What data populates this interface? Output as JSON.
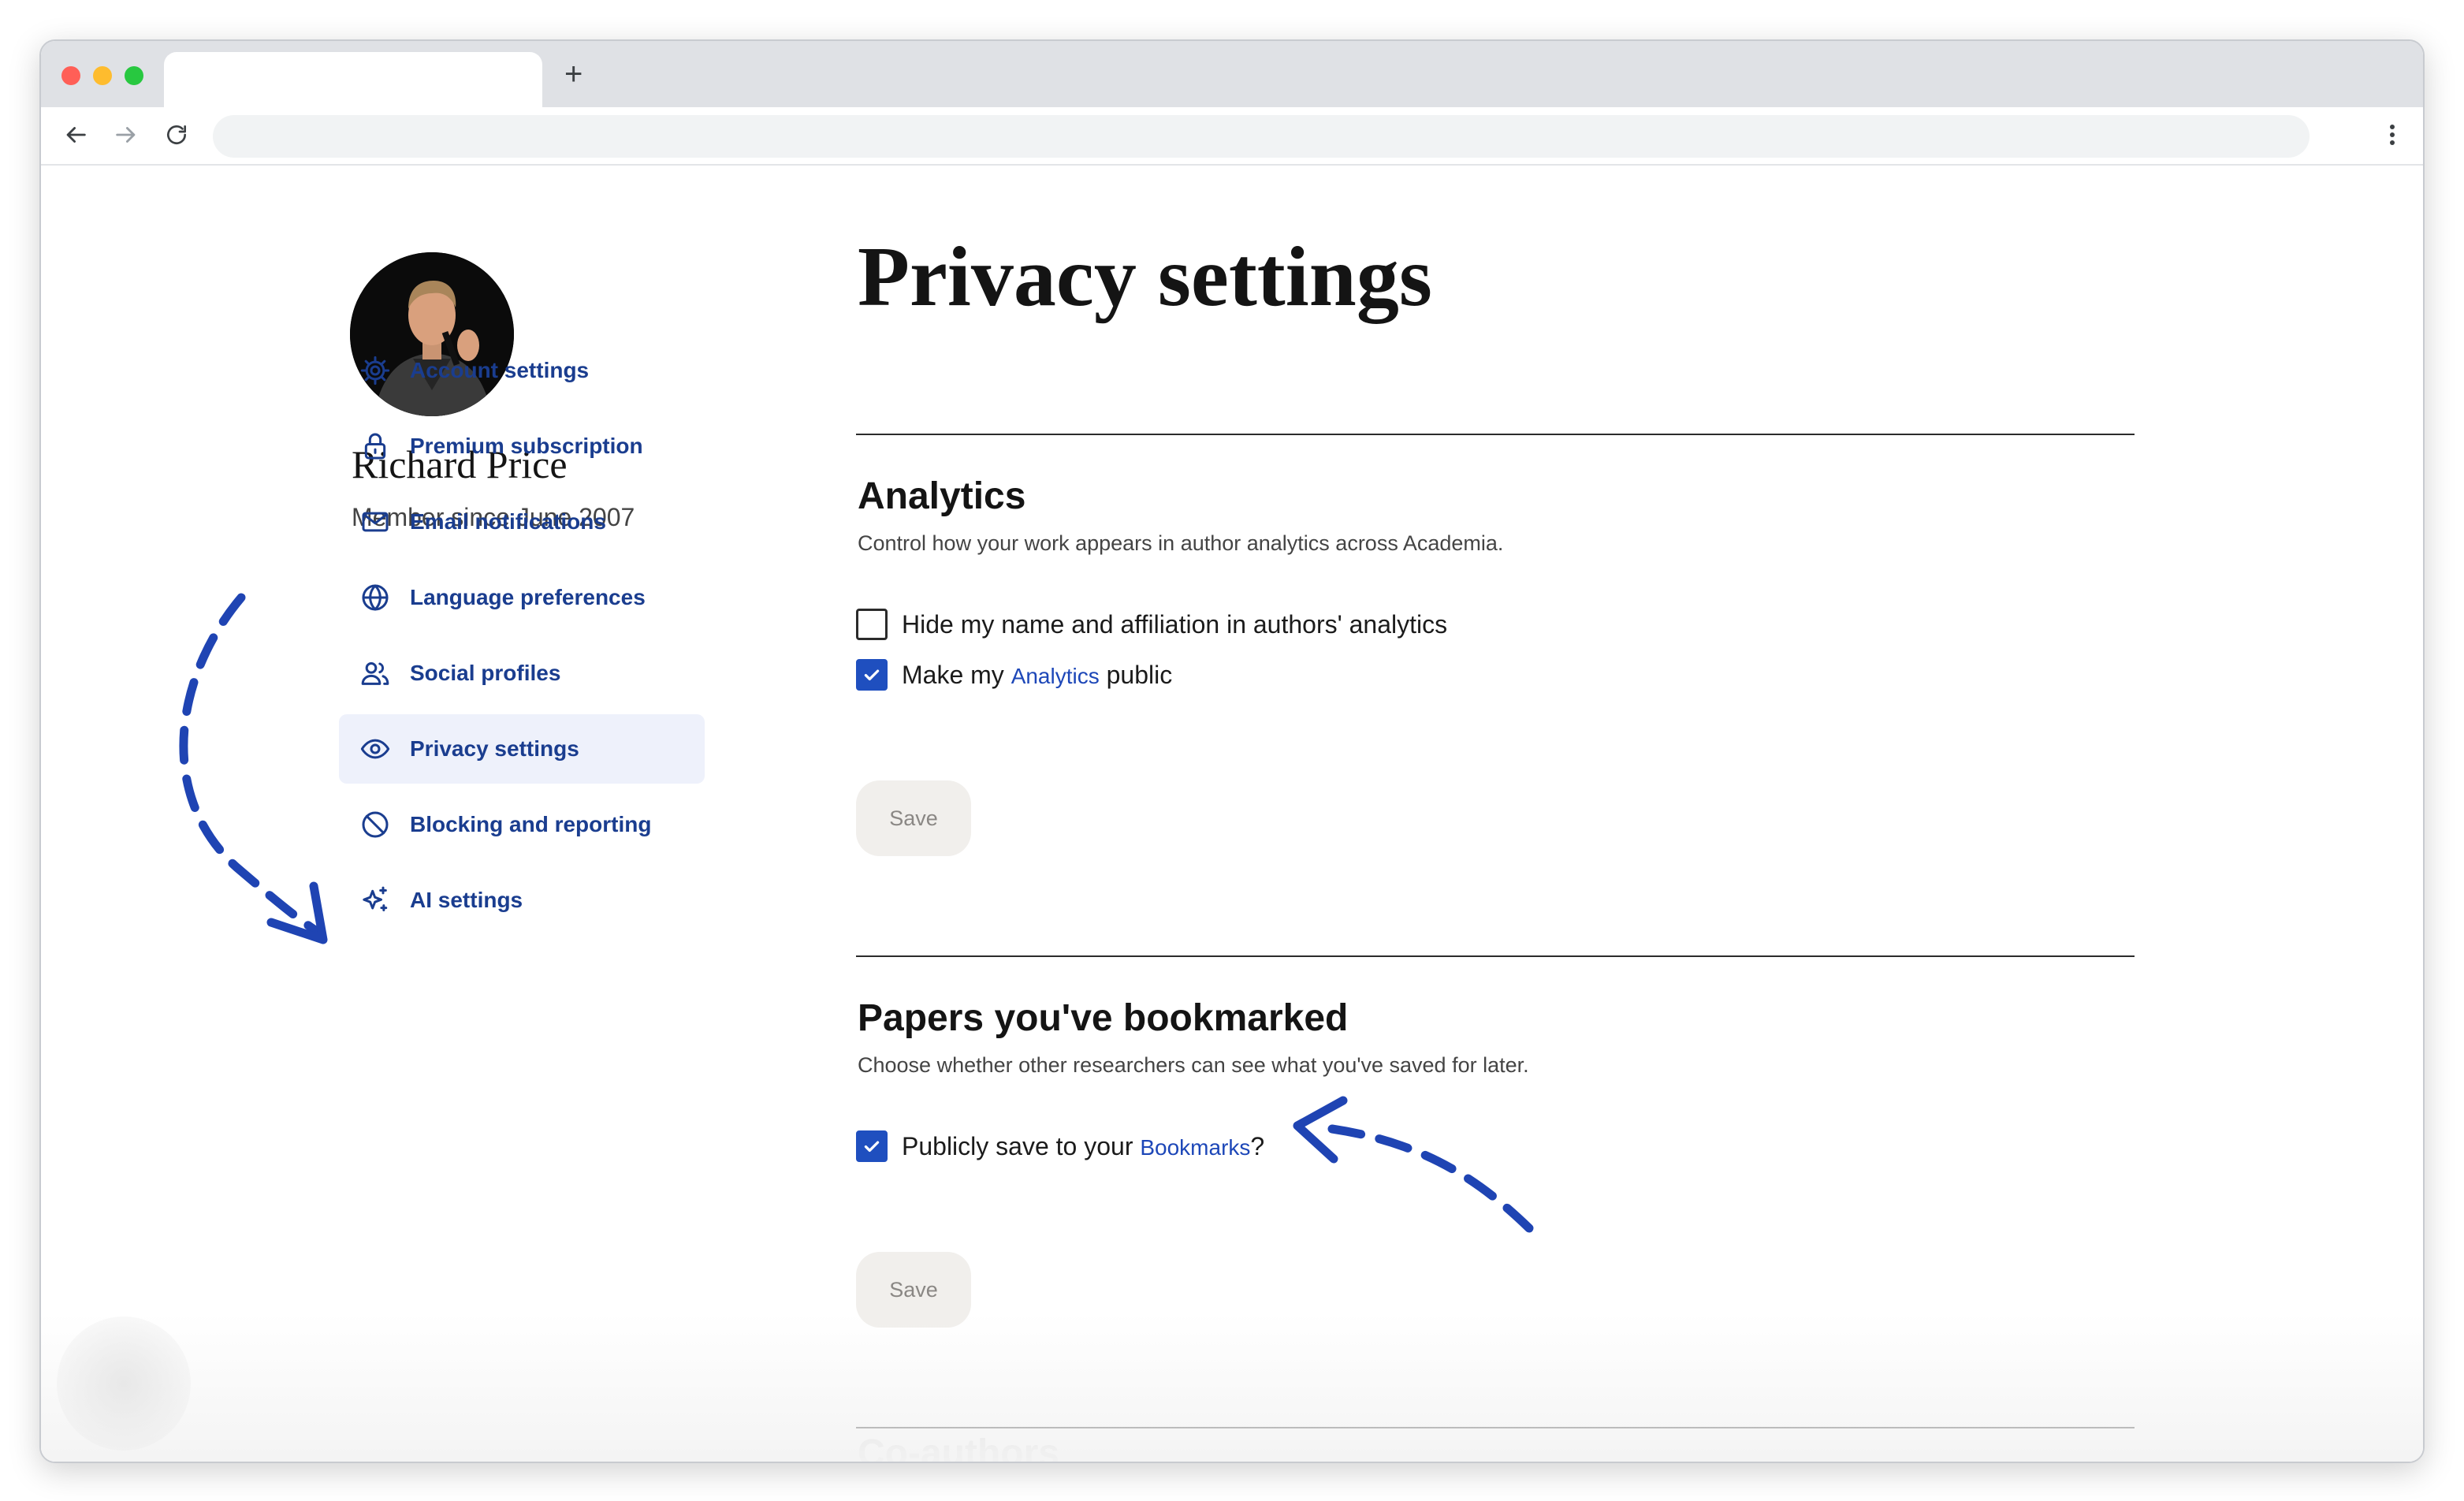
{
  "browser": {
    "new_tab_label": "+"
  },
  "profile": {
    "name": "Richard Price",
    "member_since": "Member since June 2007"
  },
  "sidebar": {
    "items": [
      {
        "label": "Account settings",
        "icon": "gear-icon",
        "active": false
      },
      {
        "label": "Premium subscription",
        "icon": "lock-icon",
        "active": false
      },
      {
        "label": "Email notifications",
        "icon": "envelope-icon",
        "active": false
      },
      {
        "label": "Language preferences",
        "icon": "globe-icon",
        "active": false
      },
      {
        "label": "Social profiles",
        "icon": "people-icon",
        "active": false
      },
      {
        "label": "Privacy settings",
        "icon": "eye-icon",
        "active": true
      },
      {
        "label": "Blocking and reporting",
        "icon": "block-icon",
        "active": false
      },
      {
        "label": "AI settings",
        "icon": "sparkle-icon",
        "active": false
      }
    ]
  },
  "main": {
    "title": "Privacy settings",
    "analytics": {
      "title": "Analytics",
      "description": "Control how your work appears in author analytics across Academia.",
      "hide_name_label": "Hide my name and affiliation in authors' analytics",
      "hide_name_checked": false,
      "public_prefix": "Make my",
      "public_link": "Analytics",
      "public_suffix": "public",
      "public_checked": true,
      "save_label": "Save"
    },
    "bookmarks": {
      "title": "Papers you've bookmarked",
      "description": "Choose whether other researchers can see what you've saved for later.",
      "save_prefix": "Publicly save to your",
      "save_link": "Bookmarks",
      "save_suffix": "?",
      "publicly_checked": true,
      "save_label": "Save"
    },
    "coauthors": {
      "title": "Co-authors"
    }
  },
  "colors": {
    "accent": "#1f4fbf",
    "link": "#1d47b8",
    "nav_text": "#1a3d8f",
    "annotation_arrow": "#1f44b3"
  }
}
